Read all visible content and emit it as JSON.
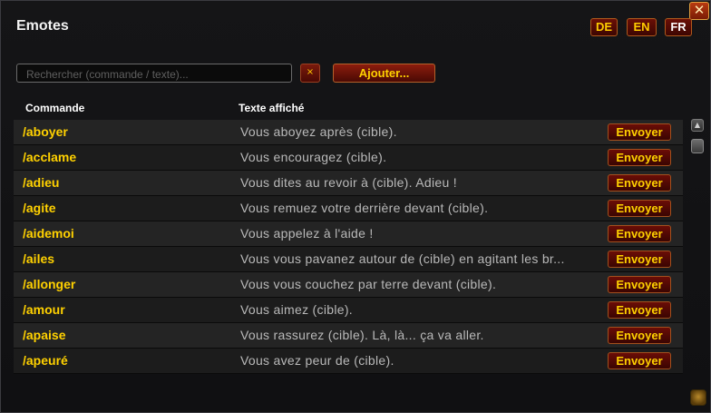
{
  "window": {
    "title": "Emotes",
    "close_label": "✕"
  },
  "languages": [
    {
      "label": "DE",
      "active": false
    },
    {
      "label": "EN",
      "active": false
    },
    {
      "label": "FR",
      "active": true
    }
  ],
  "toolbar": {
    "search_placeholder": "Rechercher (commande / texte)...",
    "search_value": "",
    "clear_label": "×",
    "add_label": "Ajouter..."
  },
  "columns": {
    "command": "Commande",
    "text": "Texte affiché"
  },
  "send_label": "Envoyer",
  "emotes": [
    {
      "command": "/aboyer",
      "text": "Vous aboyez après (cible)."
    },
    {
      "command": "/acclame",
      "text": "Vous encouragez (cible)."
    },
    {
      "command": "/adieu",
      "text": "Vous dites au revoir à (cible). Adieu !"
    },
    {
      "command": "/agite",
      "text": "Vous remuez votre derrière devant (cible)."
    },
    {
      "command": "/aidemoi",
      "text": "Vous appelez à l'aide !"
    },
    {
      "command": "/ailes",
      "text": "Vous vous pavanez autour de (cible) en agitant les br..."
    },
    {
      "command": "/allonger",
      "text": "Vous vous couchez par terre devant (cible)."
    },
    {
      "command": "/amour",
      "text": "Vous aimez (cible)."
    },
    {
      "command": "/apaise",
      "text": "Vous rassurez (cible). Là, là... ça va aller."
    },
    {
      "command": "/apeuré",
      "text": "Vous avez peur de (cible)."
    }
  ],
  "scrollbar": {
    "up_icon": "▲"
  },
  "icons": {
    "resize": "resize-grip-icon"
  }
}
